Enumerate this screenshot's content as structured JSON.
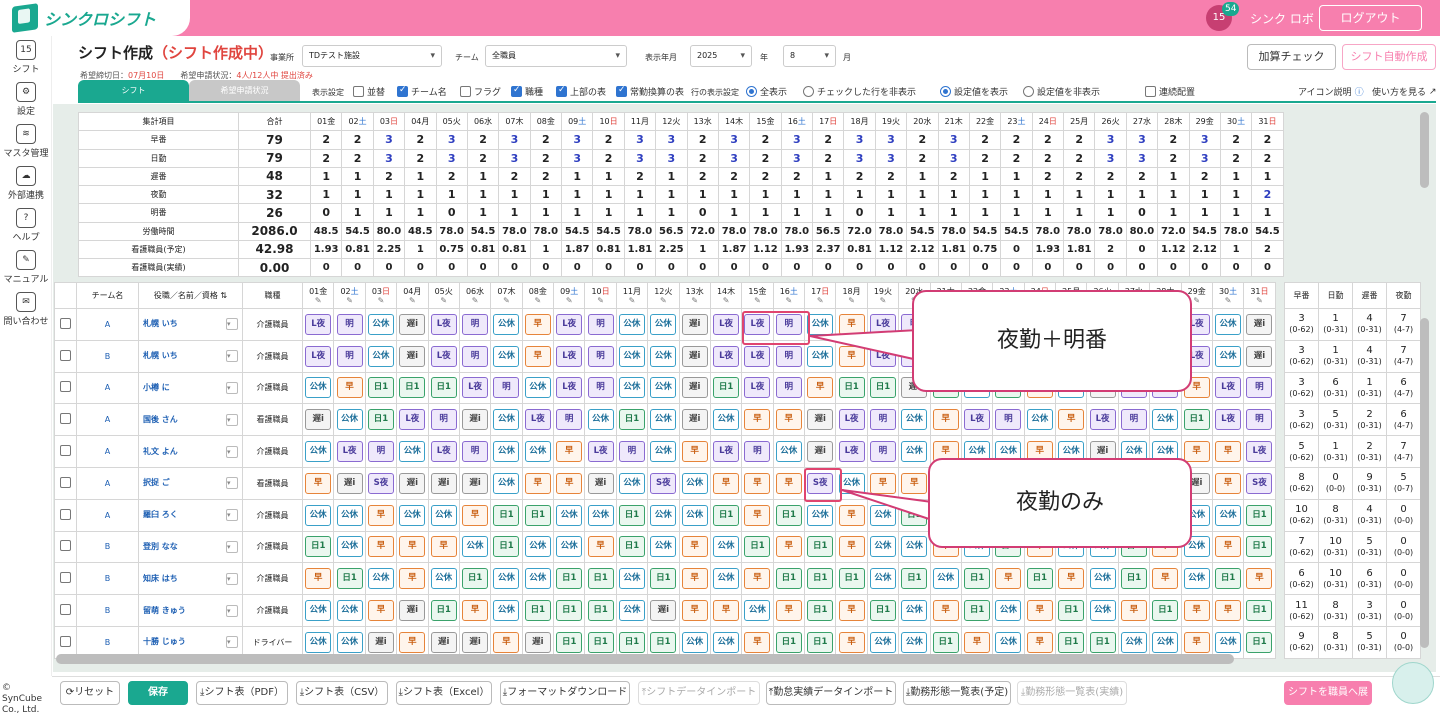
{
  "app": {
    "logo": "シンクロシフト",
    "user": "シンク ロボ",
    "logout": "ログアウト",
    "calendar_day": "15",
    "notification_count": "54"
  },
  "sidebar": [
    {
      "label": "シフト",
      "icon": "calendar-icon"
    },
    {
      "label": "設定",
      "icon": "gear-icon"
    },
    {
      "label": "マスタ管理",
      "icon": "database-icon"
    },
    {
      "label": "外部連携",
      "icon": "cloud-sync-icon"
    },
    {
      "label": "ヘルプ",
      "icon": "help-icon"
    },
    {
      "label": "マニュアル",
      "icon": "manual-icon"
    },
    {
      "label": "問い合わせ",
      "icon": "mail-icon"
    }
  ],
  "copyright": "© SynCube Co., Ltd.",
  "header": {
    "title": "シフト作成",
    "title_sub": "（シフト作成中）",
    "deadline_label": "希望締切日：",
    "deadline": "07月10日",
    "status_label": "希望申請状況：",
    "status": "4人/12人中 提出済み",
    "office_label": "事業所",
    "office": "TDテスト施設",
    "team_label": "チーム",
    "team": "全職員",
    "year_month_label": "表示年月",
    "year": "2025",
    "year_unit": "年",
    "month": "8",
    "month_unit": "月",
    "check_button": "加算チェック",
    "auto_button": "シフト自動作成"
  },
  "tabs": {
    "shift": "シフト",
    "request": "希望申請状況"
  },
  "options": {
    "display_label": "表示設定",
    "items": [
      {
        "label": "並替",
        "checked": false
      },
      {
        "label": "チーム名",
        "checked": true
      },
      {
        "label": "フラグ",
        "checked": false
      },
      {
        "label": "職種",
        "checked": true
      },
      {
        "label": "上部の表",
        "checked": true
      },
      {
        "label": "常勤換算の表",
        "checked": true
      }
    ],
    "row_label": "行の表示設定",
    "row_all": "全表示",
    "row_hide": "チェックした行を非表示",
    "val_show": "設定値を表示",
    "val_hide": "設定値を非表示",
    "continuous": "連続配置",
    "icon_help": "アイコン説明",
    "howto": "使い方を見る"
  },
  "days": [
    {
      "d": "01",
      "w": "金"
    },
    {
      "d": "02",
      "w": "土"
    },
    {
      "d": "03",
      "w": "日"
    },
    {
      "d": "04",
      "w": "月"
    },
    {
      "d": "05",
      "w": "火"
    },
    {
      "d": "06",
      "w": "水"
    },
    {
      "d": "07",
      "w": "木"
    },
    {
      "d": "08",
      "w": "金"
    },
    {
      "d": "09",
      "w": "土"
    },
    {
      "d": "10",
      "w": "日"
    },
    {
      "d": "11",
      "w": "月"
    },
    {
      "d": "12",
      "w": "火"
    },
    {
      "d": "13",
      "w": "水"
    },
    {
      "d": "14",
      "w": "木"
    },
    {
      "d": "15",
      "w": "金"
    },
    {
      "d": "16",
      "w": "土"
    },
    {
      "d": "17",
      "w": "日"
    },
    {
      "d": "18",
      "w": "月"
    },
    {
      "d": "19",
      "w": "火"
    },
    {
      "d": "20",
      "w": "水"
    },
    {
      "d": "21",
      "w": "木"
    },
    {
      "d": "22",
      "w": "金"
    },
    {
      "d": "23",
      "w": "土"
    },
    {
      "d": "24",
      "w": "日"
    },
    {
      "d": "25",
      "w": "月"
    },
    {
      "d": "26",
      "w": "火"
    },
    {
      "d": "27",
      "w": "水"
    },
    {
      "d": "28",
      "w": "木"
    },
    {
      "d": "29",
      "w": "金"
    },
    {
      "d": "30",
      "w": "土"
    },
    {
      "d": "31",
      "w": "日"
    }
  ],
  "summary": {
    "h_item": "集計項目",
    "h_total": "合計",
    "rows": [
      {
        "label": "早番",
        "total": "79",
        "v": [
          "2",
          "2",
          "3",
          "2",
          "3",
          "2",
          "3",
          "2",
          "3",
          "2",
          "3",
          "3",
          "2",
          "3",
          "2",
          "3",
          "2",
          "3",
          "3",
          "2",
          "3",
          "2",
          "2",
          "2",
          "2",
          "3",
          "3",
          "2",
          "3",
          "2",
          "2"
        ]
      },
      {
        "label": "日勤",
        "total": "79",
        "v": [
          "2",
          "2",
          "3",
          "2",
          "3",
          "2",
          "3",
          "2",
          "3",
          "2",
          "3",
          "3",
          "2",
          "3",
          "2",
          "3",
          "2",
          "3",
          "3",
          "2",
          "3",
          "2",
          "2",
          "2",
          "2",
          "3",
          "3",
          "2",
          "3",
          "2",
          "2"
        ]
      },
      {
        "label": "遅番",
        "total": "48",
        "v": [
          "1",
          "1",
          "2",
          "1",
          "2",
          "1",
          "2",
          "2",
          "1",
          "1",
          "2",
          "1",
          "2",
          "2",
          "2",
          "2",
          "1",
          "2",
          "2",
          "1",
          "2",
          "1",
          "1",
          "2",
          "2",
          "2",
          "2",
          "1",
          "2",
          "1",
          "1"
        ]
      },
      {
        "label": "夜勤",
        "total": "32",
        "v": [
          "1",
          "1",
          "1",
          "1",
          "1",
          "1",
          "1",
          "1",
          "1",
          "1",
          "1",
          "1",
          "1",
          "1",
          "1",
          "1",
          "1",
          "1",
          "1",
          "1",
          "1",
          "1",
          "1",
          "1",
          "1",
          "1",
          "1",
          "1",
          "1",
          "1",
          "2"
        ]
      },
      {
        "label": "明番",
        "total": "26",
        "v": [
          "0",
          "1",
          "1",
          "1",
          "0",
          "1",
          "1",
          "1",
          "1",
          "1",
          "1",
          "1",
          "0",
          "1",
          "1",
          "1",
          "1",
          "0",
          "1",
          "1",
          "1",
          "1",
          "1",
          "1",
          "1",
          "1",
          "0",
          "1",
          "1",
          "1",
          "1"
        ]
      },
      {
        "label": "労働時間",
        "total": "2086.0",
        "v": [
          "48.5",
          "54.5",
          "80.0",
          "48.5",
          "78.0",
          "54.5",
          "78.0",
          "78.0",
          "54.5",
          "54.5",
          "78.0",
          "56.5",
          "72.0",
          "78.0",
          "78.0",
          "78.0",
          "56.5",
          "72.0",
          "78.0",
          "54.5",
          "78.0",
          "54.5",
          "54.5",
          "78.0",
          "78.0",
          "78.0",
          "80.0",
          "72.0",
          "54.5",
          "78.0",
          "54.5",
          "73.5"
        ]
      },
      {
        "label": "看護職員(予定)",
        "total": "42.98",
        "v": [
          "1.93",
          "0.81",
          "2.25",
          "1",
          "0.75",
          "0.81",
          "0.81",
          "1",
          "1.87",
          "0.81",
          "1.81",
          "2.25",
          "1",
          "1.87",
          "1.12",
          "1.93",
          "2.37",
          "0.81",
          "1.12",
          "2.12",
          "1.81",
          "0.75",
          "0",
          "1.93",
          "1.81",
          "2",
          "0",
          "1.12",
          "2.12",
          "1",
          "2"
        ]
      },
      {
        "label": "看護職員(実績)",
        "total": "0.00",
        "v": [
          "0",
          "0",
          "0",
          "0",
          "0",
          "0",
          "0",
          "0",
          "0",
          "0",
          "0",
          "0",
          "0",
          "0",
          "0",
          "0",
          "0",
          "0",
          "0",
          "0",
          "0",
          "0",
          "0",
          "0",
          "0",
          "0",
          "0",
          "0",
          "0",
          "0",
          "0"
        ]
      }
    ]
  },
  "roster": {
    "h_team": "チーム名",
    "h_name": "役職／名前／資格",
    "h_job": "職種",
    "rows": [
      {
        "team": "A",
        "name": "札幌 いち",
        "job": "介護職員",
        "s": "L夜,明,公休,遅i,L夜,明,公休,早,L夜,明,公休,公休,遅i,L夜,L夜,明,公休,早,L夜,明,公休,早,L夜,明,公休,早,L夜,明,L夜,公休,遅i"
      },
      {
        "team": "B",
        "name": "札幌 いち",
        "job": "介護職員",
        "s": "L夜,明,公休,遅i,L夜,明,公休,早,L夜,明,公休,公休,遅i,L夜,L夜,明,公休,早,L夜,明,公休,早,L夜,明,公休,早,L夜,明,L夜,公休,遅i"
      },
      {
        "team": "A",
        "name": "小樽 に",
        "job": "介護職員",
        "s": "公休,早,日1,日1,日1,L夜,明,公休,L夜,明,公休,公休,遅i,日1,L夜,明,早,日1,日1,遅i,日1,公休,日1,早,公休,遅i,L夜,明,早,L夜,明"
      },
      {
        "team": "A",
        "name": "国後 さん",
        "job": "看護職員",
        "s": "遅i,公休,日1,L夜,明,遅i,公休,L夜,明,公休,日1,公休,遅i,公休,早,早,遅i,L夜,明,公休,早,L夜,明,公休,早,L夜,明,公休,日1,L夜,明"
      },
      {
        "team": "A",
        "name": "礼文 よん",
        "job": "介護職員",
        "s": "公休,L夜,明,公休,L夜,明,公休,公休,早,L夜,明,公休,早,L夜,明,公休,遅i,L夜,明,公休,早,公休,公休,早,公休,遅i,公休,公休,早,早,L夜"
      },
      {
        "team": "A",
        "name": "択捉 ご",
        "job": "看護職員",
        "s": "早,遅i,S夜,遅i,遅i,遅i,公休,早,早,遅i,公休,S夜,公休,早,早,早,S夜,公休,早,早,遅i,公休,早,遅i,公休,早,遅i,公休,遅i,早,S夜"
      },
      {
        "team": "A",
        "name": "羅臼 ろく",
        "job": "介護職員",
        "s": "公休,公休,早,公休,公休,早,日1,日1,公休,公休,日1,公休,公休,日1,早,日1,公休,早,公休,日1,公休,公休,早,日1,公休,日1,公休,早,公休,公休,日1"
      },
      {
        "team": "B",
        "name": "登別 なな",
        "job": "介護職員",
        "s": "日1,公休,早,早,早,公休,日1,公休,公休,早,日1,公休,早,公休,日1,早,日1,早,公休,公休,早,公休,日1,早,公休,公休,日1,早,公休,早,日1"
      },
      {
        "team": "B",
        "name": "知床 はち",
        "job": "介護職員",
        "s": "早,日1,公休,早,公休,日1,公休,公休,日1,日1,公休,日1,早,公休,早,日1,日1,日1,公休,日1,公休,日1,早,日1,早,公休,日1,早,公休,日1,早"
      },
      {
        "team": "B",
        "name": "留萌 きゅう",
        "job": "介護職員",
        "s": "公休,公休,早,遅i,日1,早,公休,日1,日1,日1,公休,遅i,早,早,公休,早,日1,早,日1,公休,早,日1,公休,早,日1,公休,早,日1,早,早,日1"
      },
      {
        "team": "B",
        "name": "十勝 じゅう",
        "job": "ドライバー",
        "s": "公休,公休,遅i,早,遅i,遅i,早,遅i,日1,日1,日1,日1,公休,公休,早,日1,日1,早,公休,公休,日1,早,公休,早,日1,日1,公休,公休,早,公休,日1"
      }
    ]
  },
  "stats": {
    "headers": [
      "早番",
      "日勤",
      "遅番",
      "夜勤"
    ],
    "rows": [
      [
        "3|(0-62)",
        "1|(0-31)",
        "4|(0-31)",
        "7|(4-7)"
      ],
      [
        "3|(0-62)",
        "1|(0-31)",
        "4|(0-31)",
        "7|(4-7)"
      ],
      [
        "3|(0-62)",
        "6|(0-31)",
        "1|(0-31)",
        "6|(4-7)"
      ],
      [
        "3|(0-62)",
        "5|(0-31)",
        "2|(0-31)",
        "6|(4-7)"
      ],
      [
        "5|(0-62)",
        "1|(0-31)",
        "2|(0-31)",
        "7|(4-7)"
      ],
      [
        "8|(0-62)",
        "0|(0-0)",
        "9|(0-31)",
        "5|(0-7)"
      ],
      [
        "10|(0-62)",
        "8|(0-31)",
        "4|(0-31)",
        "0|(0-0)"
      ],
      [
        "7|(0-62)",
        "10|(0-31)",
        "5|(0-31)",
        "0|(0-0)"
      ],
      [
        "6|(0-62)",
        "10|(0-31)",
        "6|(0-31)",
        "0|(0-0)"
      ],
      [
        "11|(0-62)",
        "8|(0-31)",
        "3|(0-31)",
        "0|(0-0)"
      ],
      [
        "9|(0-62)",
        "8|(0-31)",
        "5|(0-31)",
        "0|(0-0)"
      ]
    ]
  },
  "callouts": {
    "night_plus_off": "夜勤＋明番",
    "night_only": "夜勤のみ"
  },
  "bottom": {
    "reset": "リセット",
    "save": "保存",
    "pdf": "シフト表（PDF）",
    "csv": "シフト表（CSV）",
    "excel": "シフト表（Excel）",
    "format_dl": "フォーマットダウンロード",
    "import": "シフトデータインポート",
    "attendance_import": "勤怠実績データインポート",
    "plan_list": "勤務形態一覧表(予定)",
    "actual_list": "勤務形態一覧表(実績)",
    "deploy": "シフトを職員へ展開"
  }
}
